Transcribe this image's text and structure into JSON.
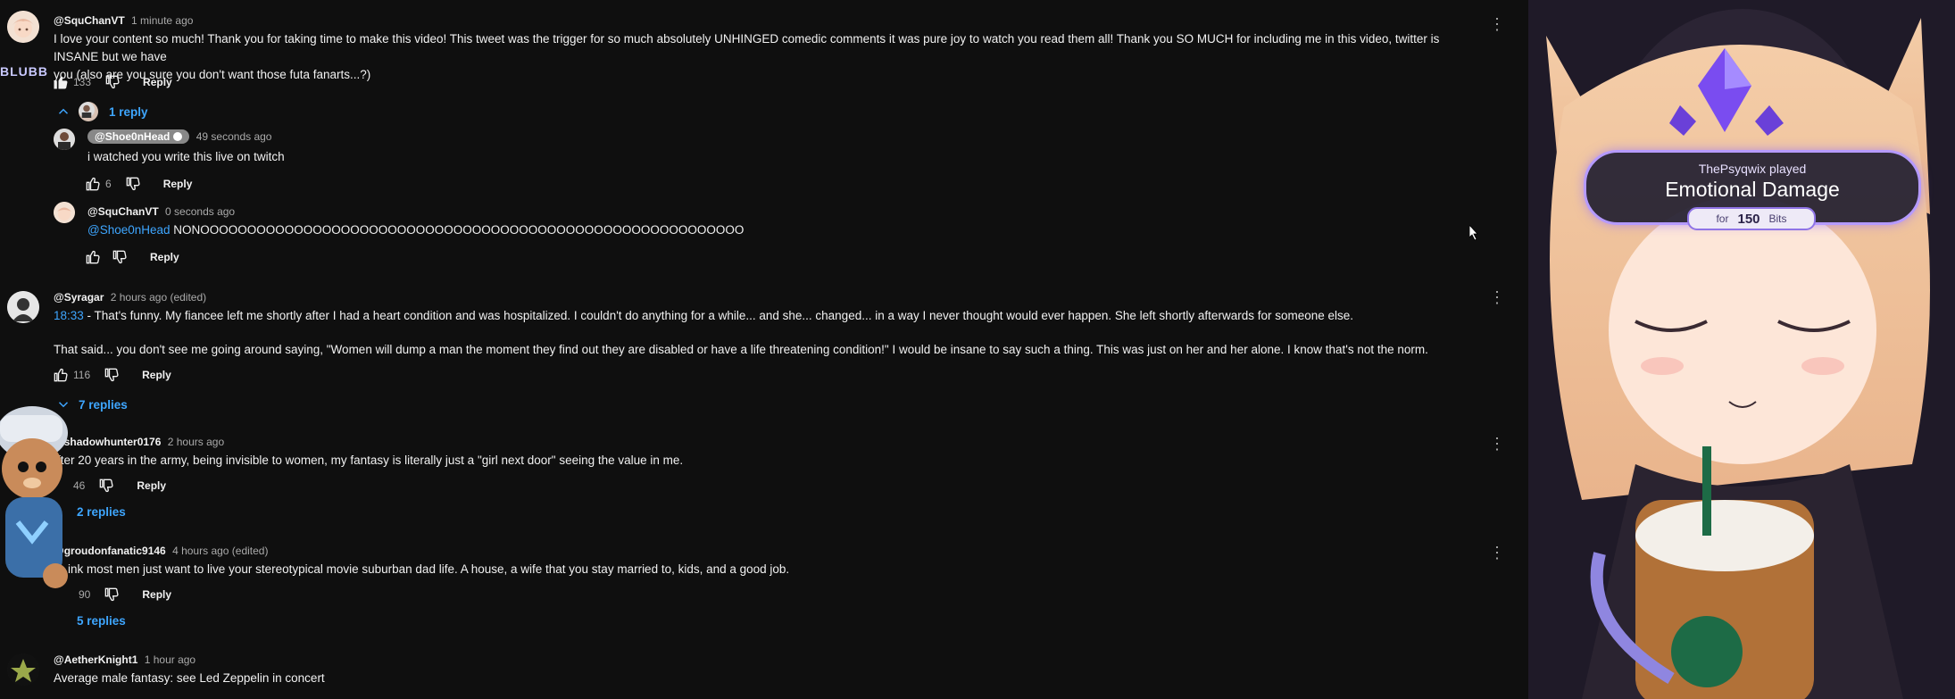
{
  "comments": [
    {
      "author": "@SquChanVT",
      "timestamp": "1 minute ago",
      "text_line1": "I love your content so much! Thank you for taking time to make this video! This tweet was the trigger for so much absolutely UNHINGED comedic comments it was pure joy to watch you read them all! Thank you SO MUCH for including me in this video, twitter is INSANE but we have",
      "text_line2": "you (also are you sure you don't want those futa fanarts...?)",
      "likes": "133",
      "reply_label": "Reply",
      "replies_toggle": "1 reply"
    },
    {
      "author": "@Syragar",
      "timestamp": "2 hours ago (edited)",
      "timestamp_link": "18:33",
      "text_line1": " - That's funny. My fiancee left me shortly after I had a heart condition and was hospitalized. I couldn't do anything for a while... and she... changed... in a way I never thought would ever happen. She left shortly afterwards for someone else.",
      "text_line2": "That said... you don't see me going around saying, \"Women will dump a man the moment they find out they are disabled or have a life threatening condition!\" I would be insane to say such a thing. This was just on her and her alone.  I know that's not the norm.",
      "likes": "116",
      "reply_label": "Reply",
      "replies_toggle": "7 replies"
    },
    {
      "author": "@shadowhunter0176",
      "timestamp": "2 hours ago",
      "text_line1": "fter 20 years in the army, being invisible to women, my fantasy is literally just a \"girl next door\" seeing the value in me.",
      "likes": "46",
      "reply_label": "Reply",
      "replies_toggle": "2 replies"
    },
    {
      "author": "@groudonfanatic9146",
      "timestamp": "4 hours ago (edited)",
      "text_line1": "ink most men just want to live your stereotypical movie suburban dad life. A house, a wife that you stay married to, kids, and a good job.",
      "likes": "90",
      "reply_label": "Reply",
      "replies_toggle": "5 replies"
    },
    {
      "author": "@AetherKnight1",
      "timestamp": "1 hour ago",
      "text_line1": "Average male fantasy: see Led Zeppelin in concert"
    }
  ],
  "replies": [
    {
      "author": "@Shoe0nHead",
      "timestamp": "49 seconds ago",
      "text": "i watched you write this live on twitch",
      "likes": "6",
      "reply_label": "Reply"
    },
    {
      "author": "@SquChanVT",
      "timestamp": "0 seconds ago",
      "mention": "@Shoe0nHead",
      "text": " NONOOOOOOOOOOOOOOOOOOOOOOOOOOOOOOOOOOOOOOOOOOOOOOOOOOOOOOOOOO",
      "reply_label": "Reply"
    }
  ],
  "overlay": {
    "alert_sub": "ThePsyqwix played",
    "alert_title": "Emotional Damage",
    "pill_for": "for",
    "pill_amount": "150",
    "pill_unit": "Bits",
    "blubb": "BLUBB"
  },
  "colors": {
    "background": "#0f0f0f",
    "link": "#3ea6ff",
    "alert_border": "#b59aff"
  }
}
